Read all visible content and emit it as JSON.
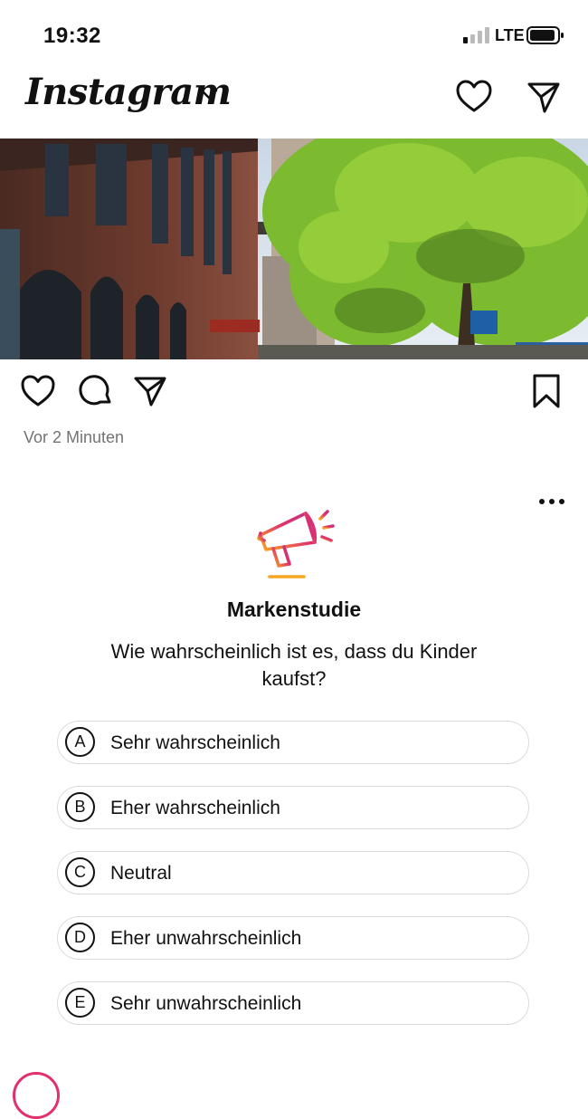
{
  "status_bar": {
    "time": "19:32",
    "network": "LTE"
  },
  "header": {
    "logo": "Instagram",
    "icons": [
      "chevron-down-icon",
      "heart-icon",
      "direct-message-icon"
    ]
  },
  "post": {
    "timestamp": "Vor 2 Minuten",
    "actions": [
      "like",
      "comment",
      "share",
      "save"
    ]
  },
  "survey": {
    "title": "Markenstudie",
    "question": "Wie wahrscheinlich ist es, dass du Kinder kaufst?",
    "options": [
      {
        "letter": "A",
        "label": "Sehr wahrscheinlich"
      },
      {
        "letter": "B",
        "label": "Eher wahrscheinlich"
      },
      {
        "letter": "C",
        "label": "Neutral"
      },
      {
        "letter": "D",
        "label": "Eher unwahrscheinlich"
      },
      {
        "letter": "E",
        "label": "Sehr unwahrscheinlich"
      }
    ]
  },
  "colors": {
    "text": "#111111",
    "secondary_text": "#737373",
    "option_border": "#dbdbdb",
    "gradient_orange": "#f5a623",
    "gradient_pink": "#e1306c",
    "gradient_purple": "#c13584"
  }
}
